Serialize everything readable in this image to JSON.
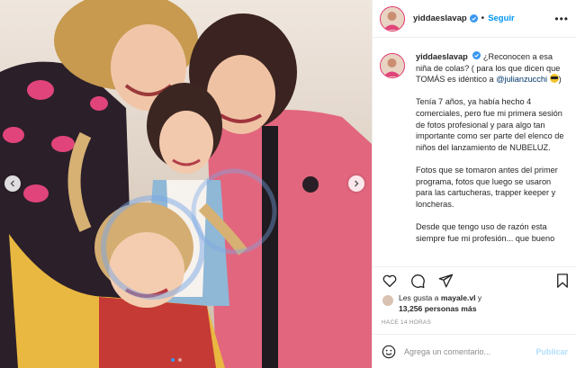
{
  "colors": {
    "accent": "#0095f6",
    "verified": "#3897f0",
    "text": "#262626",
    "muted": "#8e8e8e",
    "publish_disabled": "#b2dffc"
  },
  "post": {
    "photo_alt": "",
    "carousel": {
      "dots": 2,
      "active": 1
    }
  },
  "header": {
    "username": "yiddaeslavap",
    "separator": "•",
    "follow_label": "Seguir",
    "more_icon": "more-horizontal-icon"
  },
  "caption": {
    "username": "yiddaeslavap",
    "line1": "¿Reconocen a esa niña de colas? ( para los que dicen que TOMÁS es idéntico a",
    "mention": "@julianzucchi",
    "line1_end": ")",
    "paragraph2": "Tenía 7 años, ya había hecho 4 comerciales, pero fue mi primera sesión de fotos profesional y para algo tan importante como ser parte del elenco de niños del lanzamiento de NUBELUZ.",
    "paragraph3": "Fotos que se tomaron antes del primer programa, fotos que luego se usaron para las cartucheras, trapper keeper y loncheras.",
    "paragraph4": "Desde que tengo uso de razón esta siempre fue mi profesión... que bueno"
  },
  "actions": {
    "like_icon": "heart-icon",
    "comment_icon": "comment-icon",
    "share_icon": "send-icon",
    "save_icon": "bookmark-icon"
  },
  "likes": {
    "prefix": "Les gusta a",
    "user": "mayale.vl",
    "connector": "y",
    "count": "13,256",
    "suffix": "personas más"
  },
  "timestamp": "HACE 14 HORAS",
  "comment": {
    "placeholder": "Agrega un comentario...",
    "publish_label": "Publicar"
  }
}
